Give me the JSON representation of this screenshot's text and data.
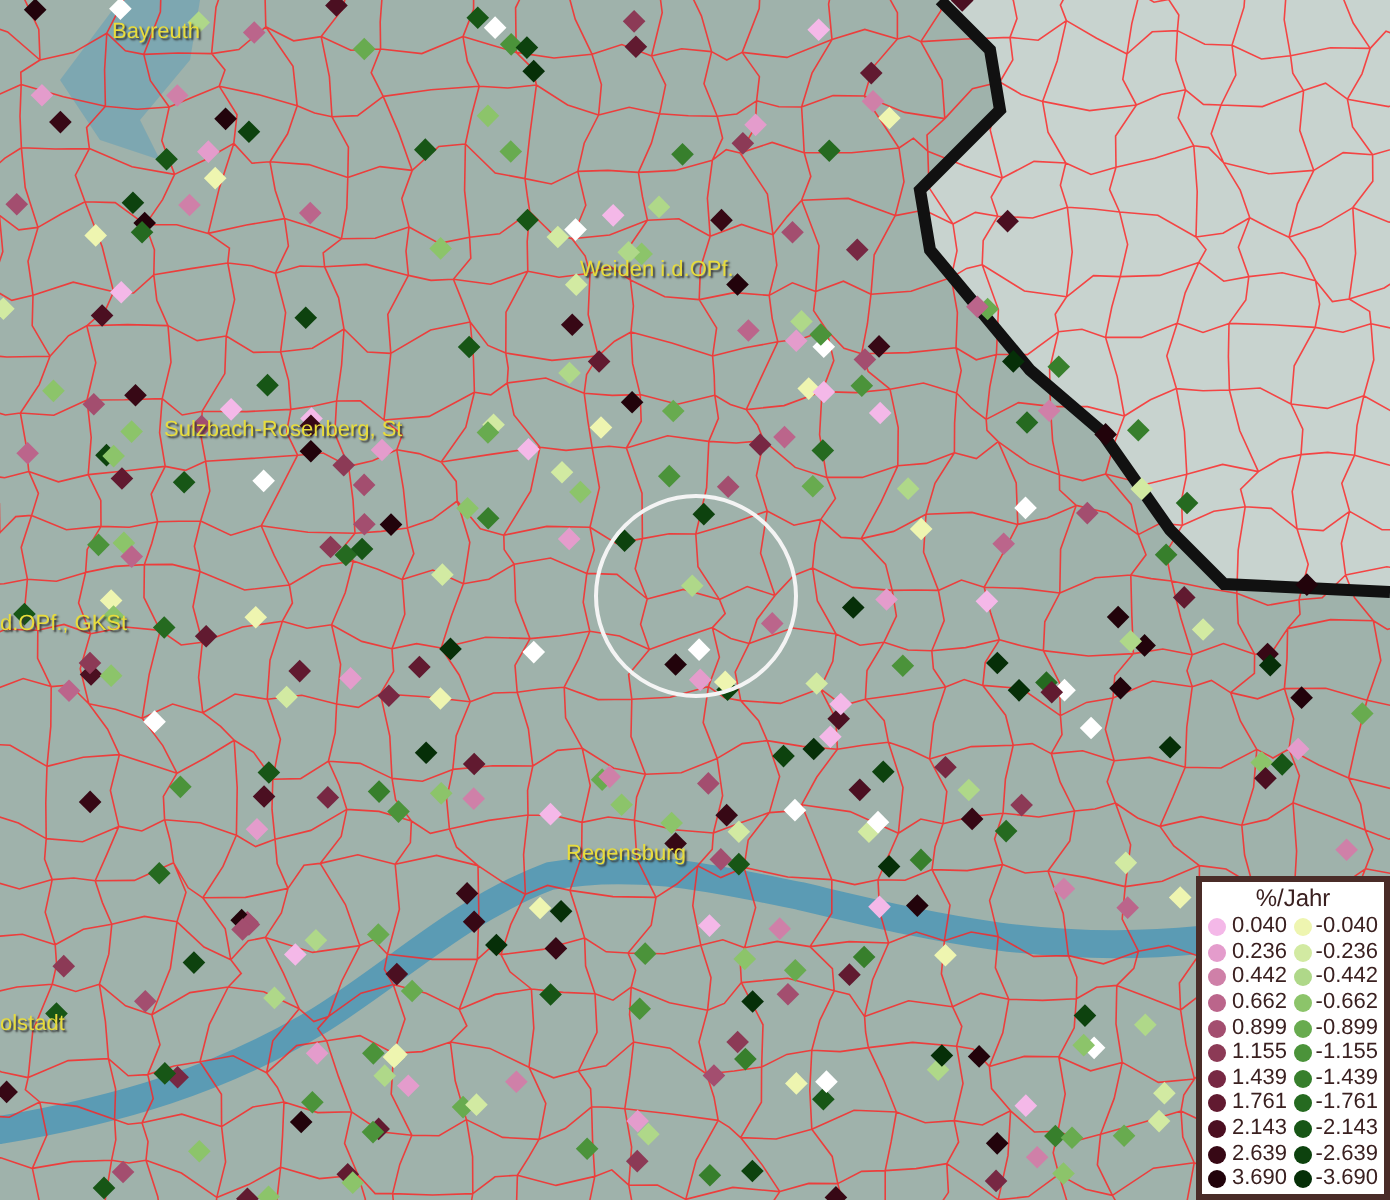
{
  "map": {
    "labels": [
      {
        "text": "Bayreuth"
      },
      {
        "text": "Weiden i.d.OPf."
      },
      {
        "text": "Sulzbach-Rosenberg, St"
      },
      {
        "text": "d.OPf., GKSt"
      },
      {
        "text": "Regensburg"
      },
      {
        "text": "olstadt"
      }
    ]
  },
  "legend": {
    "title": "%/Jahr",
    "rows": [
      {
        "positive": {
          "label": "0.040",
          "color": "#f4b8e8"
        },
        "negative": {
          "label": "-0.040",
          "color": "#eef5b0"
        }
      },
      {
        "positive": {
          "label": "0.236",
          "color": "#e49ccc"
        },
        "negative": {
          "label": "-0.236",
          "color": "#d2eaa2"
        }
      },
      {
        "positive": {
          "label": "0.442",
          "color": "#cf80a8"
        },
        "negative": {
          "label": "-0.442",
          "color": "#afd889"
        }
      },
      {
        "positive": {
          "label": "0.662",
          "color": "#bb658b"
        },
        "negative": {
          "label": "-0.662",
          "color": "#8cc46a"
        }
      },
      {
        "positive": {
          "label": "0.899",
          "color": "#a34e6f"
        },
        "negative": {
          "label": "-0.899",
          "color": "#68ab4f"
        }
      },
      {
        "positive": {
          "label": "1.155",
          "color": "#8c3a56"
        },
        "negative": {
          "label": "-1.155",
          "color": "#4b933a"
        }
      },
      {
        "positive": {
          "label": "1.439",
          "color": "#772843"
        },
        "negative": {
          "label": "-1.439",
          "color": "#377f2c"
        }
      },
      {
        "positive": {
          "label": "1.761",
          "color": "#611a30"
        },
        "negative": {
          "label": "-1.761",
          "color": "#256a20"
        }
      },
      {
        "positive": {
          "label": "2.143",
          "color": "#4b0f21"
        },
        "negative": {
          "label": "-2.143",
          "color": "#175616"
        }
      },
      {
        "positive": {
          "label": "2.639",
          "color": "#370815"
        },
        "negative": {
          "label": "-2.639",
          "color": "#0d420e"
        }
      },
      {
        "positive": {
          "label": "3.690",
          "color": "#22030b"
        },
        "negative": {
          "label": "-3.690",
          "color": "#062f08"
        }
      }
    ]
  }
}
